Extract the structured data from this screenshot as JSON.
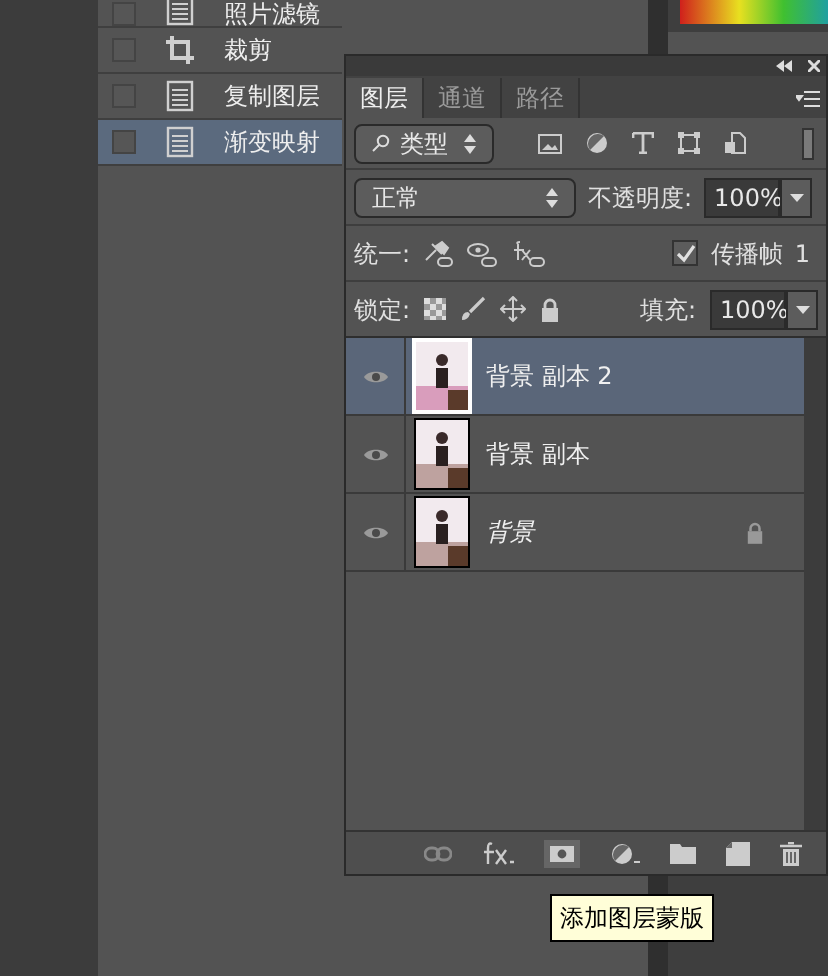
{
  "actions": [
    {
      "label": "照片滤镜",
      "kind": "doc",
      "checked": false,
      "selected": false
    },
    {
      "label": "裁剪",
      "kind": "crop",
      "checked": false,
      "selected": false
    },
    {
      "label": "复制图层",
      "kind": "doc",
      "checked": false,
      "selected": false
    },
    {
      "label": "渐变映射",
      "kind": "doc",
      "checked": false,
      "selected": true
    }
  ],
  "layers_panel": {
    "tabs": [
      {
        "label": "图层",
        "selected": true
      },
      {
        "label": "通道",
        "selected": false
      },
      {
        "label": "路径",
        "selected": false
      }
    ],
    "filter": {
      "value": "类型"
    },
    "blend_mode": {
      "value": "正常"
    },
    "opacity": {
      "label": "不透明度:",
      "value": "100%"
    },
    "unify": {
      "label": "统一:"
    },
    "propagate": {
      "label": "传播帧",
      "checked": true,
      "value": "1"
    },
    "lock": {
      "label": "锁定:"
    },
    "fill": {
      "label": "填充:",
      "value": "100%"
    },
    "layers": [
      {
        "name": "背景 副本 2",
        "visible": true,
        "selected": true,
        "locked": false,
        "italic": false
      },
      {
        "name": "背景 副本",
        "visible": true,
        "selected": false,
        "locked": false,
        "italic": false
      },
      {
        "name": "背景",
        "visible": true,
        "selected": false,
        "locked": true,
        "italic": true
      }
    ],
    "tooltip": "添加图层蒙版"
  }
}
